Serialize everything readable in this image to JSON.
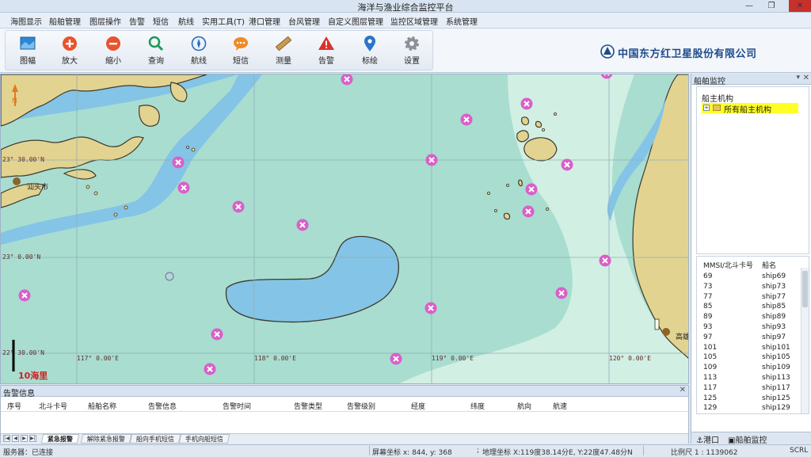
{
  "window": {
    "title": "海洋与渔业综合监控平台",
    "min": "—",
    "max": "❐",
    "close": "✕"
  },
  "menu": [
    "海图显示",
    "船舶管理",
    "图层操作",
    "告警",
    "短信",
    "航线",
    "实用工具(T)",
    "港口管理",
    "台风管理",
    "自定义图层管理",
    "监控区域管理",
    "系统管理"
  ],
  "toolbar": [
    {
      "label": "图幅",
      "icon": "chart-sheet-icon"
    },
    {
      "label": "放大",
      "icon": "zoom-in-icon"
    },
    {
      "label": "缩小",
      "icon": "zoom-out-icon"
    },
    {
      "label": "查询",
      "icon": "search-icon"
    },
    {
      "label": "航线",
      "icon": "compass-icon"
    },
    {
      "label": "短信",
      "icon": "message-icon"
    },
    {
      "label": "测量",
      "icon": "ruler-icon"
    },
    {
      "label": "告警",
      "icon": "warning-icon"
    },
    {
      "label": "标绘",
      "icon": "pin-icon"
    },
    {
      "label": "设置",
      "icon": "gear-icon"
    }
  ],
  "company": "中国东方红卫星股份有限公司",
  "map": {
    "north": "N",
    "latitudes": [
      "23° 30.00'N",
      "23° 0.00'N",
      "22° 30.00'N"
    ],
    "longitudes": [
      "117° 0.00'E",
      "118° 0.00'E",
      "119° 0.00'E",
      "120° 0.00'E"
    ],
    "cities": [
      "汕头市",
      "高雄"
    ],
    "scale": "10海里",
    "colors": {
      "sea": "#a9ddd0",
      "deep": "#84c4e6",
      "land": "#e3d391",
      "coast": "#3c3a2e",
      "shallow": "#d2efe4",
      "ship": "#d95fc9"
    }
  },
  "right_panel": {
    "title": "船舶监控",
    "owner_header": "船主机构",
    "owner_item": "所有船主机构",
    "col_mmsi": "MMSI/北斗卡号",
    "col_name": "船名",
    "ships": [
      [
        "69",
        "ship69"
      ],
      [
        "73",
        "ship73"
      ],
      [
        "77",
        "ship77"
      ],
      [
        "85",
        "ship85"
      ],
      [
        "89",
        "ship89"
      ],
      [
        "93",
        "ship93"
      ],
      [
        "97",
        "ship97"
      ],
      [
        "101",
        "ship101"
      ],
      [
        "105",
        "ship105"
      ],
      [
        "109",
        "ship109"
      ],
      [
        "113",
        "ship113"
      ],
      [
        "117",
        "ship117"
      ],
      [
        "125",
        "ship125"
      ],
      [
        "129",
        "ship129"
      ]
    ],
    "tabs": [
      "港口",
      "船舶监控"
    ]
  },
  "alarm": {
    "title": "告警信息",
    "columns": [
      "序号",
      "北斗卡号",
      "船舶名称",
      "告警信息",
      "告警时间",
      "告警类型",
      "告警级别",
      "经度",
      "纬度",
      "航向",
      "航速"
    ],
    "tabs": [
      "紧急报警",
      "解除紧急报警",
      "船向手机短信",
      "手机向船短信"
    ]
  },
  "status": {
    "server": "服务器：已连接",
    "screen": "屏幕坐标 x: 844, y: 368",
    "geo": "地理坐标 X:119度38.14分E, Y:22度47.48分N",
    "scale": "比例尺 1 : 1139062",
    "scrl": "SCRL"
  }
}
